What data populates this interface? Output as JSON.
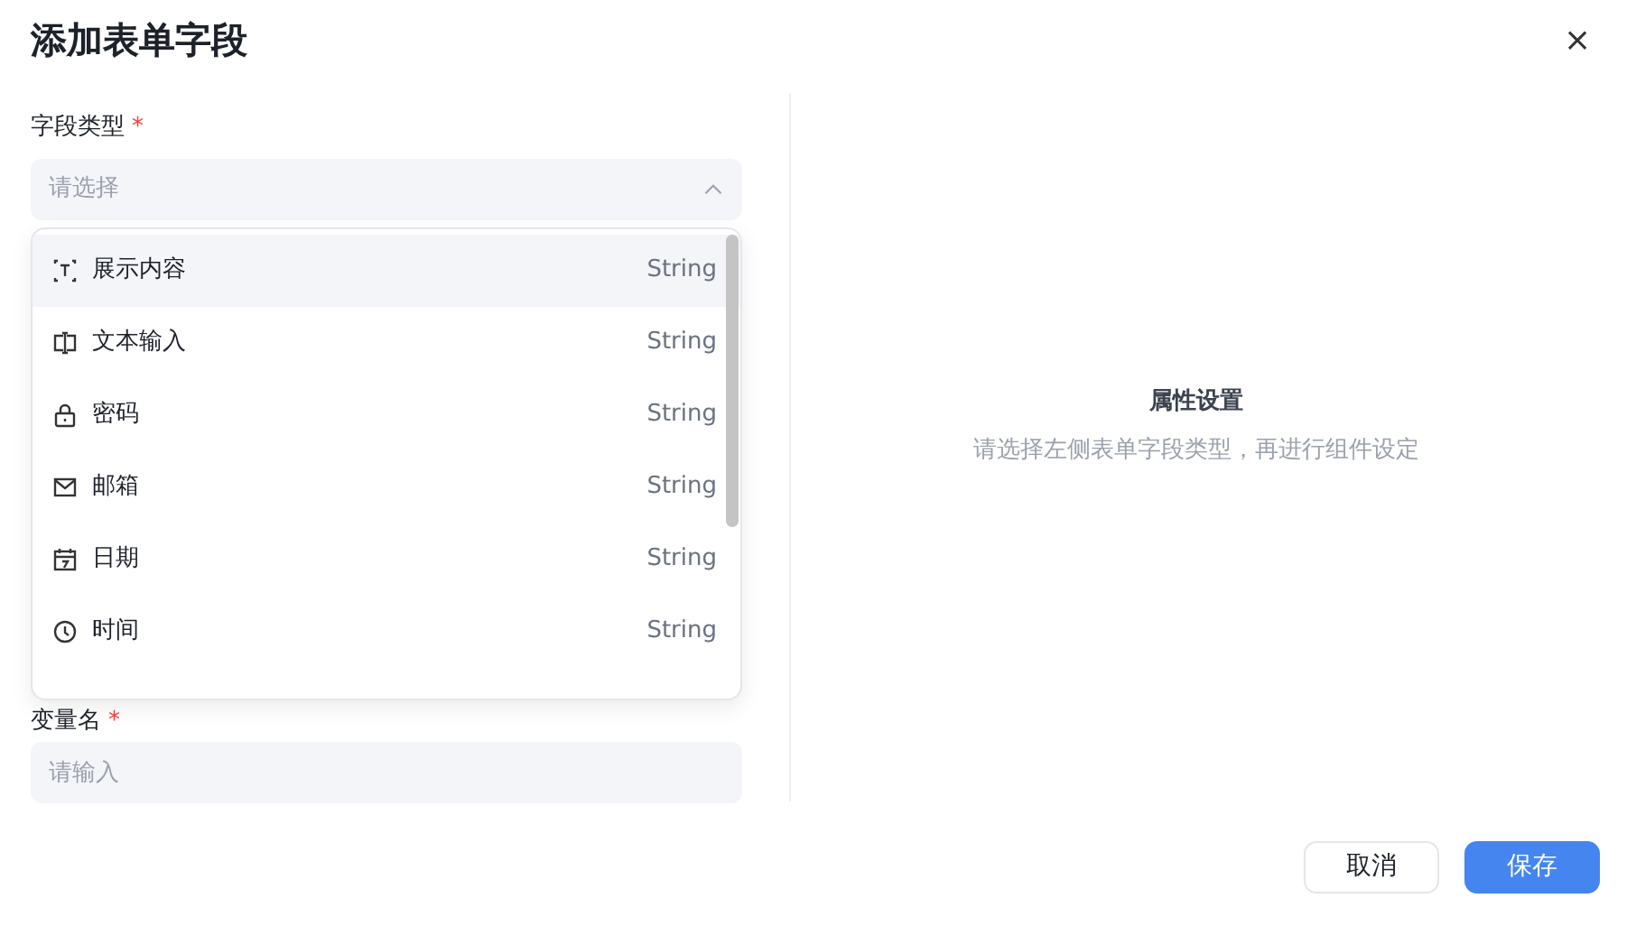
{
  "dialog": {
    "title": "添加表单字段",
    "close": "×"
  },
  "fields": [
    {
      "label": "字段类型",
      "required_mark": "*",
      "kind": "select",
      "placeholder": "请选择",
      "expanded": true
    },
    {
      "label": "变量名",
      "required_mark": "*",
      "kind": "input",
      "placeholder": "请输入"
    }
  ],
  "dropdown": {
    "options": [
      {
        "kind": "text",
        "label": "展示内容",
        "type": "String",
        "selected": true
      },
      {
        "kind": "input",
        "label": "文本输入",
        "type": "String",
        "selected": false
      },
      {
        "kind": "lock",
        "label": "密码",
        "type": "String",
        "selected": false
      },
      {
        "kind": "mail",
        "label": "邮箱",
        "type": "String",
        "selected": false
      },
      {
        "kind": "calendar",
        "label": "日期",
        "type": "String",
        "selected": false
      },
      {
        "kind": "clock",
        "label": "时间",
        "type": "String",
        "selected": false
      }
    ]
  },
  "properties": {
    "title": "属性设置",
    "hint": "请选择左侧表单字段类型，再进行组件设定"
  },
  "buttons": [
    {
      "label": "取消",
      "kind": "secondary"
    },
    {
      "label": "保存",
      "kind": "primary"
    }
  ]
}
